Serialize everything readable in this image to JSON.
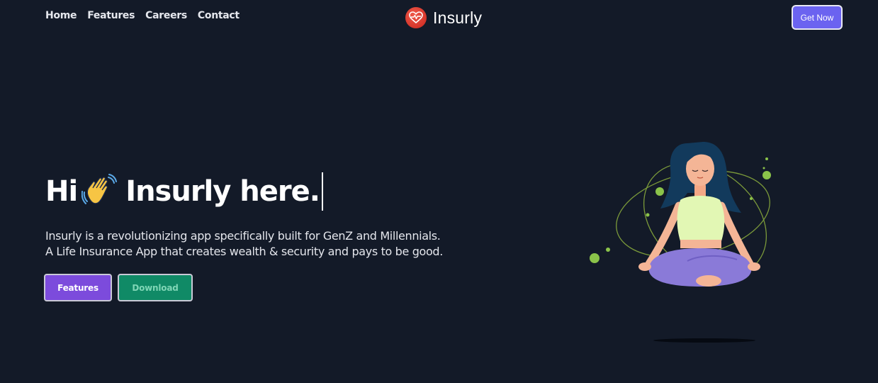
{
  "nav": {
    "links": [
      "Home",
      "Features",
      "Careers",
      "Contact"
    ],
    "get_now_label": "Get Now"
  },
  "brand": {
    "name": "Insurly",
    "logo_icon": "heart-pulse-icon"
  },
  "hero": {
    "title_prefix": "Hi",
    "title_emoji": "waving-hand-icon",
    "title_suffix": "Insurly here.",
    "description_line1": "Insurly is a revolutionizing app specifically built for GenZ and Millennials.",
    "description_line2": "A Life Insurance App that creates wealth & security and pays to be good.",
    "features_button": "Features",
    "download_button": "Download"
  },
  "colors": {
    "background": "#131a28",
    "accent_purple": "#6b63f0",
    "features_purple": "#7c4bdc",
    "download_green": "#108a66",
    "logo_red": "#e0362c"
  }
}
